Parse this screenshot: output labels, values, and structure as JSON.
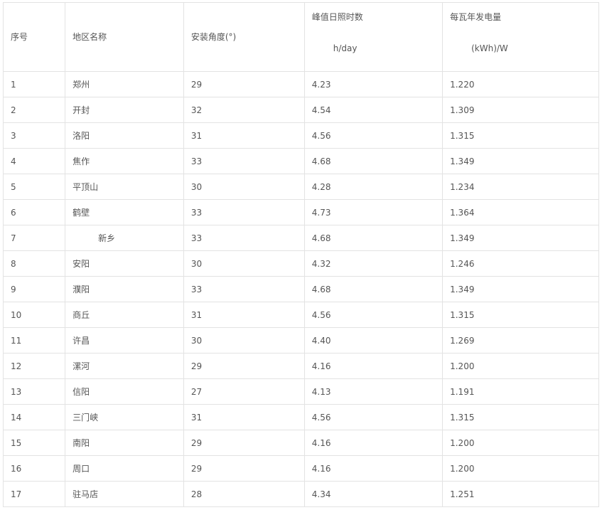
{
  "table": {
    "headers": {
      "no": "序号",
      "name": "地区名称",
      "angle": "安装角度(°)",
      "hours_line1": "峰值日照时数",
      "hours_line2": "h/day",
      "energy_line1": "每瓦年发电量",
      "energy_line2": "(kWh)/W"
    },
    "rows": [
      {
        "no": "1",
        "name": "郑州",
        "angle": "29",
        "hours": "4.23",
        "energy": "1.220"
      },
      {
        "no": "2",
        "name": "开封",
        "angle": "32",
        "hours": "4.54",
        "energy": "1.309"
      },
      {
        "no": "3",
        "name": "洛阳",
        "angle": "31",
        "hours": "4.56",
        "energy": "1.315"
      },
      {
        "no": "4",
        "name": "焦作",
        "angle": "33",
        "hours": "4.68",
        "energy": "1.349"
      },
      {
        "no": "5",
        "name": "平顶山",
        "angle": "30",
        "hours": "4.28",
        "energy": "1.234"
      },
      {
        "no": "6",
        "name": "鹤壁",
        "angle": "33",
        "hours": "4.73",
        "energy": "1.364"
      },
      {
        "no": "7",
        "name": "新乡",
        "angle": "33",
        "hours": "4.68",
        "energy": "1.349"
      },
      {
        "no": "8",
        "name": "安阳",
        "angle": "30",
        "hours": "4.32",
        "energy": "1.246"
      },
      {
        "no": "9",
        "name": "濮阳",
        "angle": "33",
        "hours": "4.68",
        "energy": "1.349"
      },
      {
        "no": "10",
        "name": "商丘",
        "angle": "31",
        "hours": "4.56",
        "energy": "1.315"
      },
      {
        "no": "11",
        "name": "许昌",
        "angle": "30",
        "hours": "4.40",
        "energy": "1.269"
      },
      {
        "no": "12",
        "name": "漯河",
        "angle": "29",
        "hours": "4.16",
        "energy": "1.200"
      },
      {
        "no": "13",
        "name": "信阳",
        "angle": "27",
        "hours": "4.13",
        "energy": "1.191"
      },
      {
        "no": "14",
        "name": "三门峡",
        "angle": "31",
        "hours": "4.56",
        "energy": "1.315"
      },
      {
        "no": "15",
        "name": "南阳",
        "angle": "29",
        "hours": "4.16",
        "energy": "1.200"
      },
      {
        "no": "16",
        "name": "周口",
        "angle": "29",
        "hours": "4.16",
        "energy": "1.200"
      },
      {
        "no": "17",
        "name": "驻马店",
        "angle": "28",
        "hours": "4.34",
        "energy": "1.251"
      }
    ]
  }
}
